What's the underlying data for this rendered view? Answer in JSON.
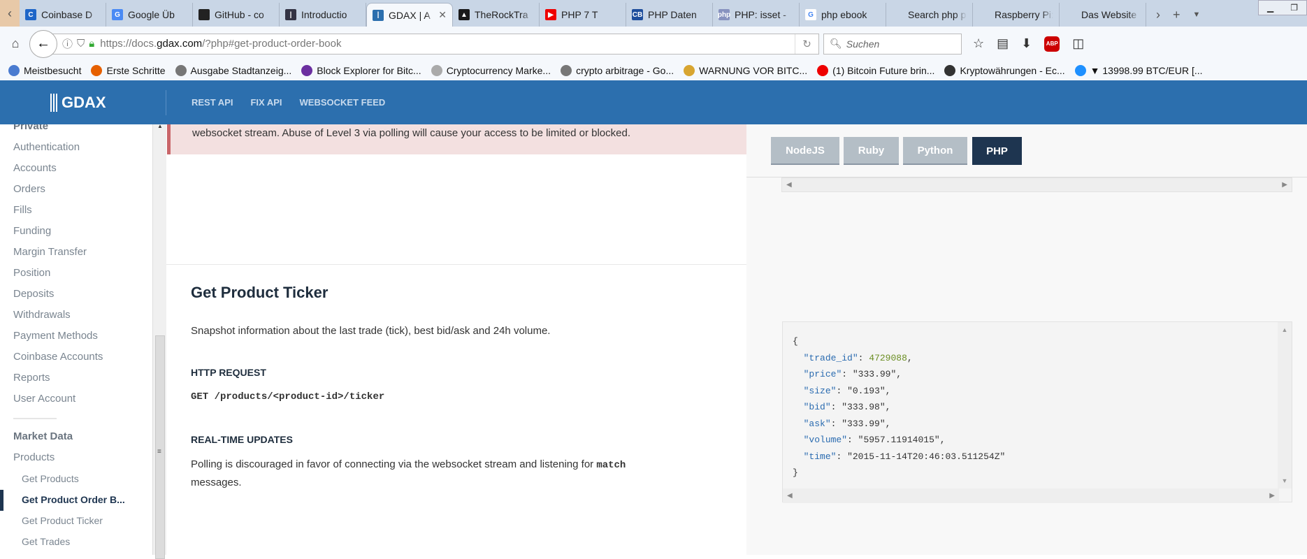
{
  "browser": {
    "tabs": [
      {
        "label": "Coinbase D",
        "color": "#1e66c8",
        "glyph": "C"
      },
      {
        "label": "Google Üb",
        "color": "#4a8af4",
        "glyph": "G"
      },
      {
        "label": "GitHub - co",
        "color": "#222",
        "glyph": ""
      },
      {
        "label": "Introductio",
        "color": "#334",
        "glyph": "|"
      },
      {
        "label": "GDAX | A",
        "color": "#2c6fae",
        "glyph": "|",
        "active": true
      },
      {
        "label": "TheRockTra",
        "color": "#1a1a1a",
        "glyph": "▲"
      },
      {
        "label": "PHP 7 T",
        "color": "#e00",
        "glyph": "▶"
      },
      {
        "label": "PHP Daten",
        "color": "#1e4e9c",
        "glyph": "CB"
      },
      {
        "label": "PHP: isset -",
        "color": "#8892bf",
        "glyph": "php"
      },
      {
        "label": "php ebook",
        "color": "#fff",
        "glyph": "G"
      },
      {
        "label": "Search php pro",
        "color": "",
        "glyph": ""
      },
      {
        "label": "Raspberry Pi: D",
        "color": "",
        "glyph": ""
      },
      {
        "label": "Das Website H",
        "color": "",
        "glyph": ""
      }
    ],
    "url_prefix": "https://docs.",
    "url_domain": "gdax.com",
    "url_rest": "/?php#get-product-order-book",
    "search_placeholder": "Suchen",
    "bookmarks": [
      "Meistbesucht",
      "Erste Schritte",
      "Ausgabe Stadtanzeig...",
      "Block Explorer for Bitc...",
      "Cryptocurrency Marke...",
      "crypto arbitrage - Go...",
      "WARNUNG VOR BITC...",
      "(1) Bitcoin Future brin...",
      "Kryptowährungen - Ec...",
      "▼ 13998.99 BTC/EUR [..."
    ]
  },
  "header": {
    "logo": "GDAX",
    "nav": [
      "REST API",
      "FIX API",
      "WEBSOCKET FEED"
    ],
    "brand_color": "#2c6fae"
  },
  "sidebar": {
    "private_heading": "Private",
    "private_items": [
      "Authentication",
      "Accounts",
      "Orders",
      "Fills",
      "Funding",
      "Margin Transfer",
      "Position",
      "Deposits",
      "Withdrawals",
      "Payment Methods",
      "Coinbase Accounts",
      "Reports",
      "User Account"
    ],
    "market_heading": "Market Data",
    "products": "Products",
    "sub_items": [
      "Get Products",
      "Get Product Order B...",
      "Get Product Ticker",
      "Get Trades"
    ],
    "active_index": 1
  },
  "content": {
    "alert_text": "websocket stream. Abuse of Level 3 via polling will cause your access to be limited or blocked.",
    "title": "Get Product Ticker",
    "description": "Snapshot information about the last trade (tick), best bid/ask and 24h volume.",
    "http_heading": "HTTP REQUEST",
    "http_request": "GET /products/<product-id>/ticker",
    "realtime_heading": "REAL-TIME UPDATES",
    "realtime_text_1": "Polling is discouraged in favor of connecting via the websocket stream and listening for",
    "realtime_code": "match",
    "realtime_text_2": "messages."
  },
  "code_panel": {
    "languages": [
      "NodeJS",
      "Ruby",
      "Python",
      "PHP"
    ],
    "active_language": "PHP",
    "response": [
      {
        "key": "trade_id",
        "value": "4729088",
        "type": "number"
      },
      {
        "key": "price",
        "value": "\"333.99\"",
        "type": "string"
      },
      {
        "key": "size",
        "value": "\"0.193\"",
        "type": "string"
      },
      {
        "key": "bid",
        "value": "\"333.98\"",
        "type": "string"
      },
      {
        "key": "ask",
        "value": "\"333.99\"",
        "type": "string"
      },
      {
        "key": "volume",
        "value": "\"5957.11914015\"",
        "type": "string"
      },
      {
        "key": "time",
        "value": "\"2015-11-14T20:46:03.511254Z\"",
        "type": "string"
      }
    ]
  }
}
